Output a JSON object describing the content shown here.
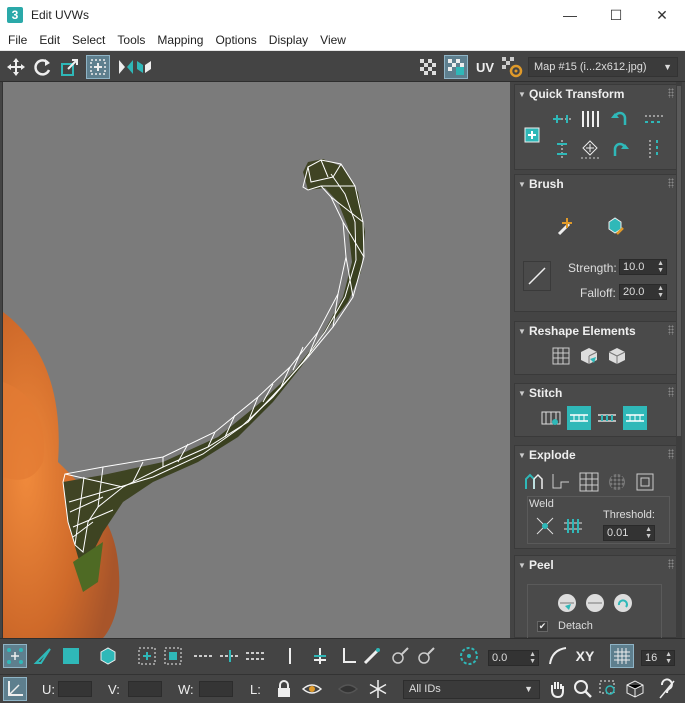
{
  "window": {
    "title": "Edit UVWs",
    "app_icon": "3",
    "minimize_glyph": "—",
    "maximize_glyph": "☐",
    "close_glyph": "✕"
  },
  "menu": [
    "File",
    "Edit",
    "Select",
    "Tools",
    "Mapping",
    "Options",
    "Display",
    "View"
  ],
  "toolbar": {
    "uv_label": "UV",
    "map_select": "Map #15 (i...2x612.jpg)"
  },
  "panel": {
    "quick_transform": {
      "title": "Quick Transform"
    },
    "brush": {
      "title": "Brush",
      "strength_label": "Strength:",
      "strength_value": "10.0",
      "falloff_label": "Falloff:",
      "falloff_value": "20.0"
    },
    "reshape": {
      "title": "Reshape Elements"
    },
    "stitch": {
      "title": "Stitch"
    },
    "explode": {
      "title": "Explode",
      "weld_label": "Weld",
      "threshold_label": "Threshold:",
      "threshold_value": "0.01"
    },
    "peel": {
      "title": "Peel",
      "detach_label": "Detach",
      "detach_checked": true
    }
  },
  "bottom": {
    "rotate_value": "0.0",
    "xy_label": "XY",
    "grid_value": "16",
    "u_label": "U:",
    "v_label": "V:",
    "w_label": "W:",
    "l_label": "L:",
    "ids_select": "All IDs"
  },
  "colors": {
    "accent": "#2fb8b8",
    "panel_bg": "#444444",
    "viewport_bg": "#7b7b7b"
  }
}
